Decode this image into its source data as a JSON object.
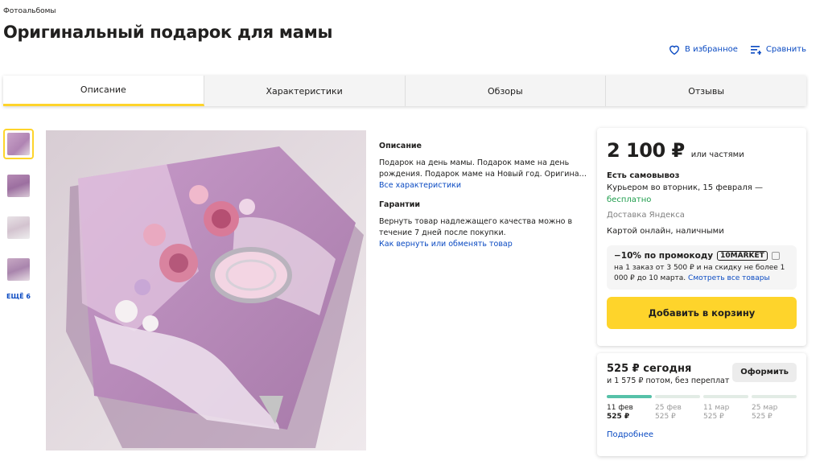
{
  "breadcrumb": "Фотоальбомы",
  "title": "Оригинальный подарок для мамы",
  "actions": {
    "favorite": "В избранное",
    "compare": "Сравнить"
  },
  "tabs": [
    "Описание",
    "Характеристики",
    "Обзоры",
    "Отзывы"
  ],
  "gallery": {
    "more": "ЕЩЁ 6"
  },
  "description": {
    "heading": "Описание",
    "text_line1": "Подарок на день мамы. Подарок маме на день",
    "text_line2": "рождения. Подарок маме на Новый год. Оригинальны...",
    "link": "Все характеристики",
    "guarantee_heading": "Гарантии",
    "guarantee_text": "Вернуть товар надлежащего качества можно в течение 7 дней после покупки.",
    "guarantee_link": "Как вернуть или обменять товар"
  },
  "offer": {
    "price": "2 100 ₽",
    "parts": "или частями",
    "pickup": "Есть самовывоз",
    "courier": "Курьером во вторник, 15 февраля —",
    "courier_free": "бесплатно",
    "delivery_by": "Доставка Яндекса",
    "payment": "Картой онлайн, наличными",
    "promo_title": "−10% по промокоду",
    "promo_code": "10MARKET",
    "promo_text": "на 1 заказ от 3 500 ₽ и на скидку не более 1 000 ₽ до 10 марта.",
    "promo_link": "Смотреть все товары",
    "cart_button": "Добавить в корзину"
  },
  "split": {
    "title": "525 ₽ сегодня",
    "subtitle": "и 1 575 ₽ потом, без переплат",
    "order_button": "Оформить",
    "payments": [
      {
        "date": "11 фев",
        "amount": "525 ₽"
      },
      {
        "date": "25 фев",
        "amount": "525 ₽"
      },
      {
        "date": "11 мар",
        "amount": "525 ₽"
      },
      {
        "date": "25 мар",
        "amount": "525 ₽"
      }
    ],
    "details_link": "Подробнее"
  },
  "colors": {
    "accent": "#fed42b",
    "link": "#0a4ac2",
    "success": "#1e9d4c",
    "split_bar": "#56c1a8"
  }
}
